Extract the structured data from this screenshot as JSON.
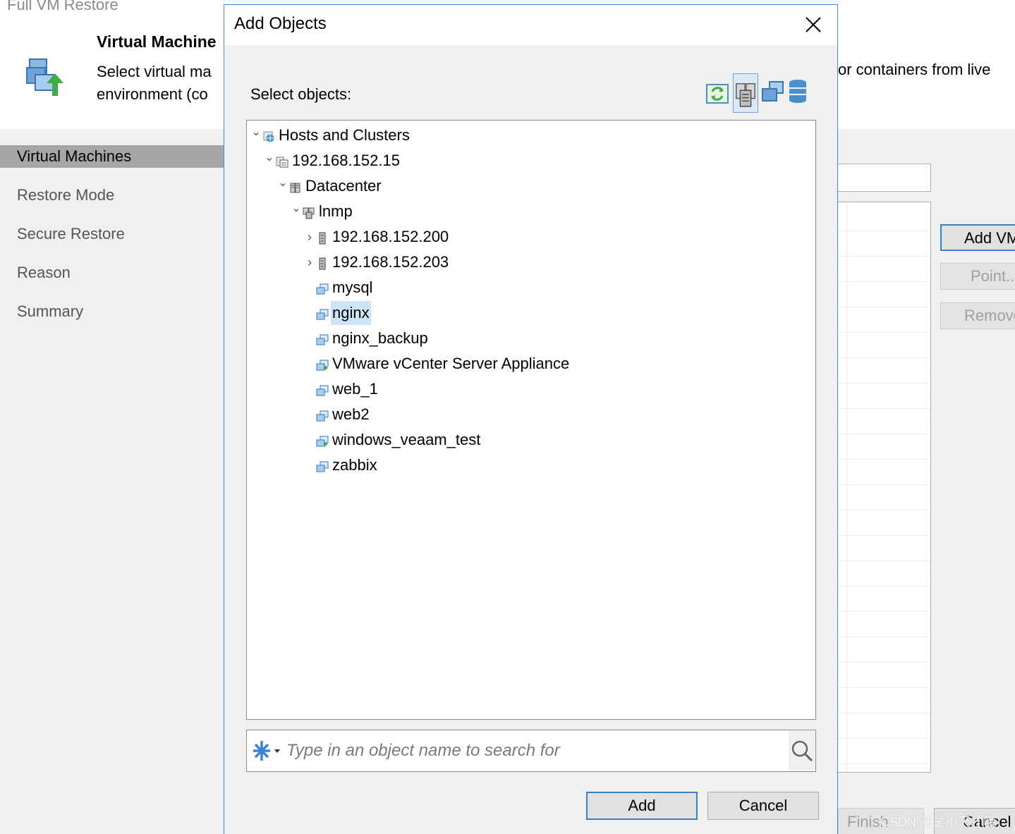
{
  "wizard": {
    "title": "Full VM Restore",
    "header_title": "Virtual Machine",
    "header_desc_line1": "Select virtual ma",
    "header_desc_line2": "environment (co",
    "header_desc_right": "or containers from live",
    "nav": [
      {
        "label": "Virtual Machines",
        "active": true
      },
      {
        "label": "Restore Mode",
        "active": false
      },
      {
        "label": "Secure Restore",
        "active": false
      },
      {
        "label": "Reason",
        "active": false
      },
      {
        "label": "Summary",
        "active": false
      }
    ],
    "side_buttons": {
      "add_vm": "Add VM",
      "point": "Point...",
      "remove": "Remove"
    },
    "footer": {
      "finish": "Finish",
      "cancel": "Cancel"
    },
    "watermark": "CSDN @是小天才哦"
  },
  "dialog": {
    "title": "Add Objects",
    "select_label": "Select objects:",
    "view_buttons": [
      {
        "icon": "refresh-icon"
      },
      {
        "icon": "hosts-and-clusters-icon",
        "active": true
      },
      {
        "icon": "vms-and-templates-icon"
      },
      {
        "icon": "datastores-icon"
      }
    ],
    "tree": [
      {
        "label": "Hosts and Clusters",
        "level": 0,
        "toggle": "expanded",
        "icon": "globe-icon"
      },
      {
        "label": "192.168.152.15",
        "level": 1,
        "toggle": "expanded",
        "icon": "vcenter-icon"
      },
      {
        "label": "Datacenter",
        "level": 2,
        "toggle": "expanded",
        "icon": "datacenter-icon"
      },
      {
        "label": "lnmp",
        "level": 3,
        "toggle": "expanded",
        "icon": "cluster-icon"
      },
      {
        "label": "192.168.152.200",
        "level": 4,
        "toggle": "collapsed",
        "icon": "host-icon"
      },
      {
        "label": "192.168.152.203",
        "level": 4,
        "toggle": "collapsed",
        "icon": "host-icon"
      },
      {
        "label": "mysql",
        "level": 4,
        "toggle": "none",
        "icon": "vm-icon"
      },
      {
        "label": "nginx",
        "level": 4,
        "toggle": "none",
        "icon": "vm-icon",
        "selected": true
      },
      {
        "label": "nginx_backup",
        "level": 4,
        "toggle": "none",
        "icon": "vm-icon"
      },
      {
        "label": "VMware vCenter Server Appliance",
        "level": 4,
        "toggle": "none",
        "icon": "vm-running-icon"
      },
      {
        "label": "web_1",
        "level": 4,
        "toggle": "none",
        "icon": "vm-icon"
      },
      {
        "label": "web2",
        "level": 4,
        "toggle": "none",
        "icon": "vm-icon"
      },
      {
        "label": "windows_veaam_test",
        "level": 4,
        "toggle": "none",
        "icon": "vm-running-icon"
      },
      {
        "label": "zabbix",
        "level": 4,
        "toggle": "none",
        "icon": "vm-icon"
      }
    ],
    "search": {
      "placeholder": "Type in an object name to search for",
      "value": ""
    },
    "buttons": {
      "add": "Add",
      "cancel": "Cancel"
    }
  },
  "colors": {
    "accent": "#3b82c4",
    "selection": "#cce4f7",
    "nav_active": "#a6a6a6",
    "dialog_bg": "#f0f0f0"
  }
}
